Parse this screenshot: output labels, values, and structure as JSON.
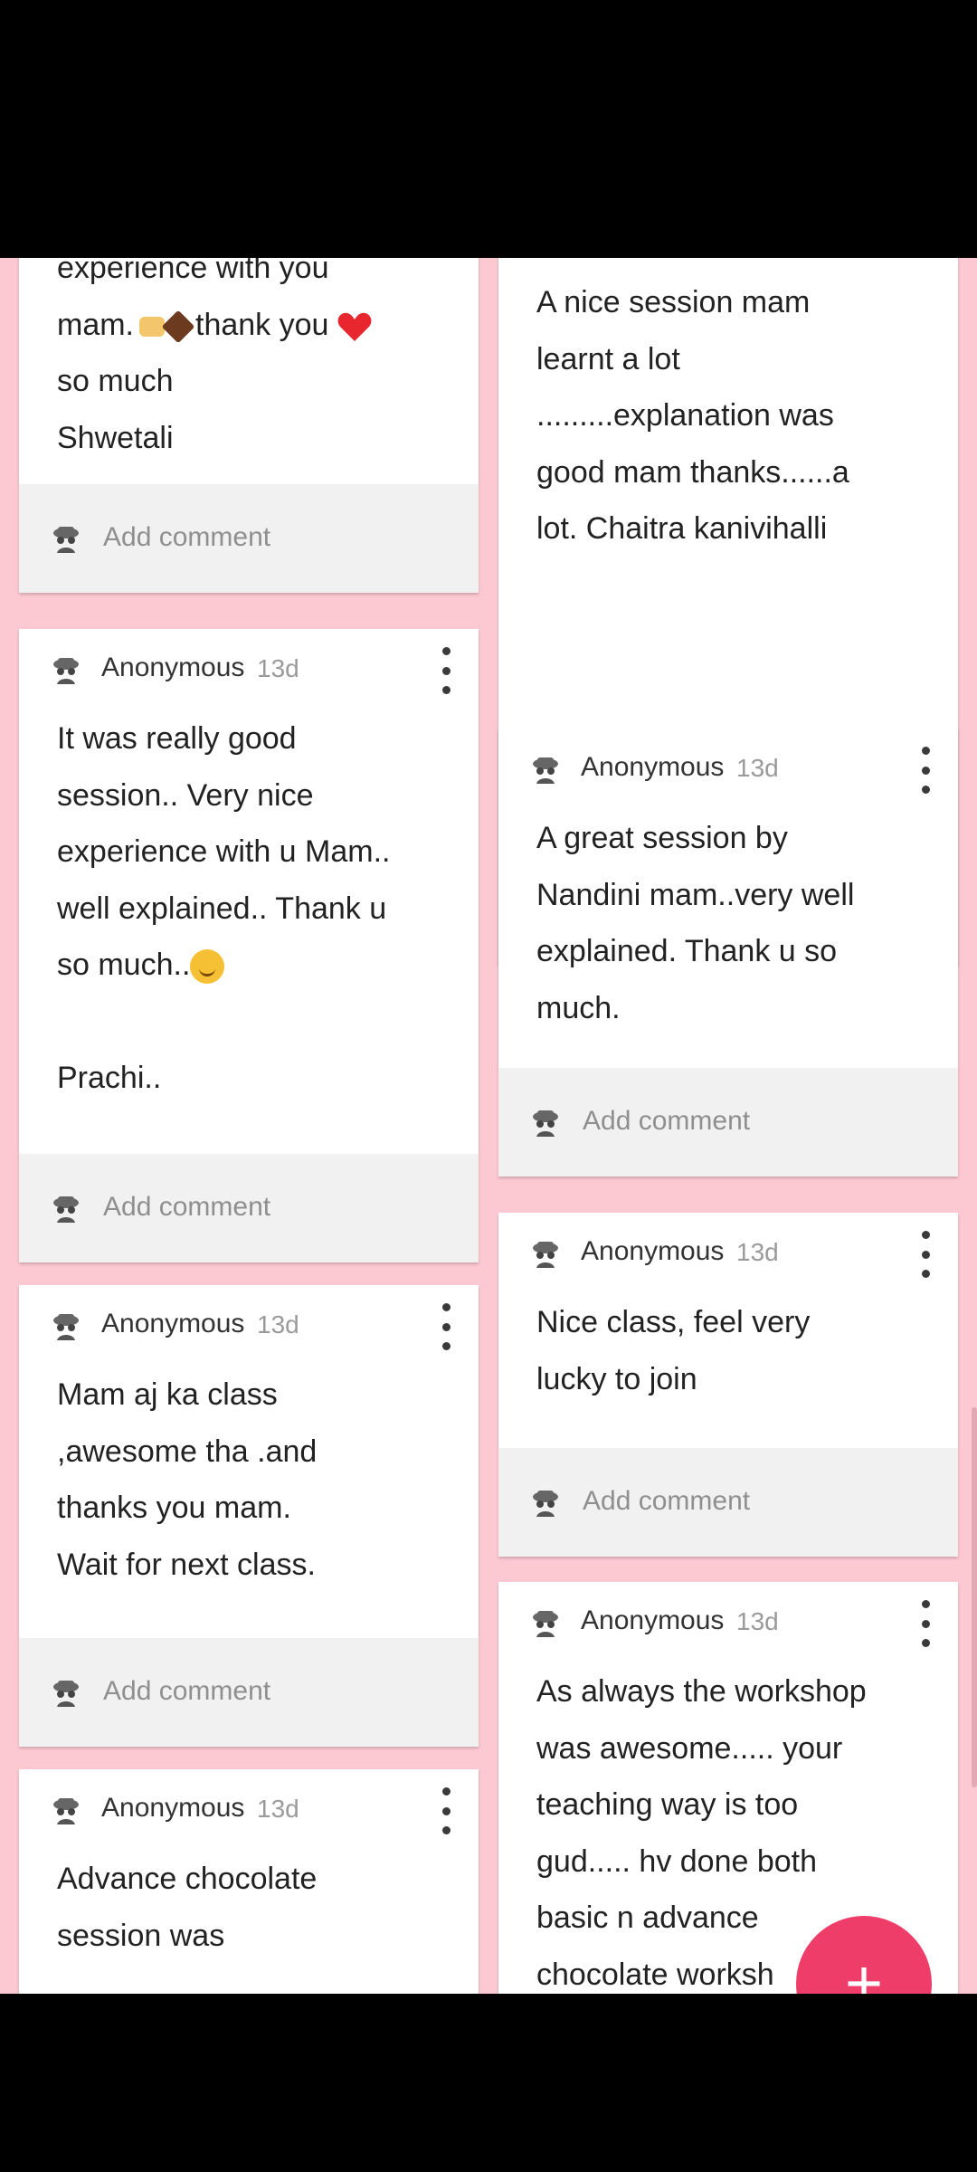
{
  "icons": {
    "avatar": "incognito-avatar-icon",
    "menu": "more-vert-icon",
    "fab": "plus-icon"
  },
  "colors": {
    "background": "#fcc8d1",
    "fab": "#ef3d6a"
  },
  "add_comment_label": "Add comment",
  "fab_label": "+",
  "left_cards": [
    {
      "lines": [
        "experience with you",
        "mam.",
        "thank you",
        "so much",
        "Shwetali"
      ]
    },
    {
      "author": "Anonymous",
      "time": "13d",
      "lines": [
        "It was really good",
        "session.. Very nice",
        "experience with u Mam..",
        "well explained.. Thank u",
        "so much..",
        "",
        "Prachi.."
      ]
    },
    {
      "author": "Anonymous",
      "time": "13d",
      "lines": [
        "Mam  aj ka class",
        ",awesome  tha .and",
        "thanks you mam.",
        "Wait  for next class."
      ]
    },
    {
      "author": "Anonymous",
      "time": "13d",
      "lines": [
        "Advance chocolate",
        "session was"
      ]
    }
  ],
  "right_cards": [
    {
      "lines": [
        "A nice session mam",
        "learnt a lot",
        ".........explanation was",
        "good mam thanks......a",
        "lot.   Chaitra kanivihalli"
      ]
    },
    {
      "author": "Anonymous",
      "time": "13d",
      "lines": [
        "A great session by",
        "Nandini mam..very well",
        "explained. Thank u so",
        "much."
      ]
    },
    {
      "author": "Anonymous",
      "time": "13d",
      "lines": [
        "Nice class, feel very",
        "lucky  to join"
      ]
    },
    {
      "author": "Anonymous",
      "time": "13d",
      "lines": [
        "As always the workshop",
        "was awesome.....  your",
        "teaching way is too",
        "gud..... hv done both",
        "basic n advance",
        "chocolate worksh"
      ]
    }
  ]
}
